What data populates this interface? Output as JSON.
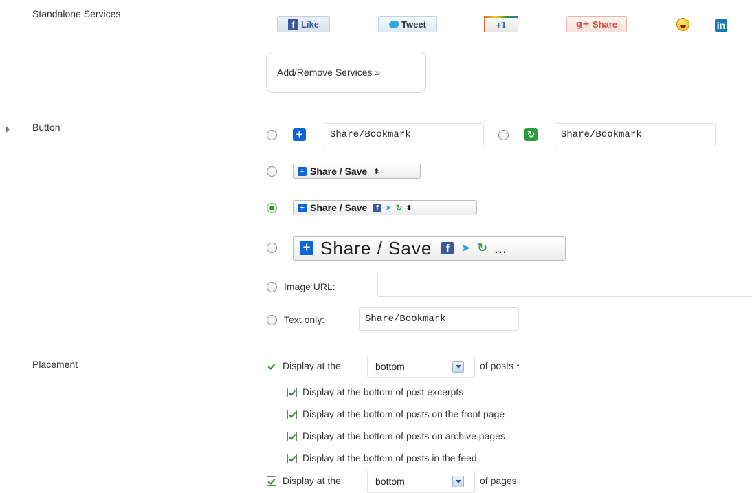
{
  "standalone": {
    "label": "Standalone Services",
    "facebook": "Like",
    "twitter": "Tweet",
    "googleplus_one": "+1",
    "googleplus_share": "Share",
    "googleplus_prefix": "g+",
    "add_remove": "Add/Remove Services »",
    "icons": [
      "facebook-icon",
      "twitter-icon",
      "google-plus-icon",
      "yahoo-smiley-icon",
      "linkedin-icon"
    ]
  },
  "button": {
    "label": "Button",
    "option1_value": "Share/Bookmark",
    "option2_value": "Share/Bookmark",
    "share_save_small": "Share / Save",
    "share_save_icons": "Share / Save",
    "share_save_large": "Share / Save",
    "large_ellipsis": "...",
    "image_url_label": "Image URL:",
    "image_url_value": "",
    "text_only_label": "Text only:",
    "text_only_value": "Share/Bookmark",
    "selected_option": 4
  },
  "placement": {
    "label": "Placement",
    "posts_prefix": "Display at the",
    "posts_position": "bottom",
    "posts_suffix": "of posts *",
    "sub_options": [
      "Display at the bottom of post excerpts",
      "Display at the bottom of posts on the front page",
      "Display at the bottom of posts on archive pages",
      "Display at the bottom of posts in the feed"
    ],
    "pages_prefix": "Display at the",
    "pages_position": "bottom",
    "pages_suffix": "of pages"
  },
  "colors": {
    "facebook": "#3b5998",
    "twitter": "#2fa6e0",
    "google": "#dd4b39",
    "addtoany_blue": "#0a66d8",
    "addtoany_green": "#2a9b3a"
  }
}
